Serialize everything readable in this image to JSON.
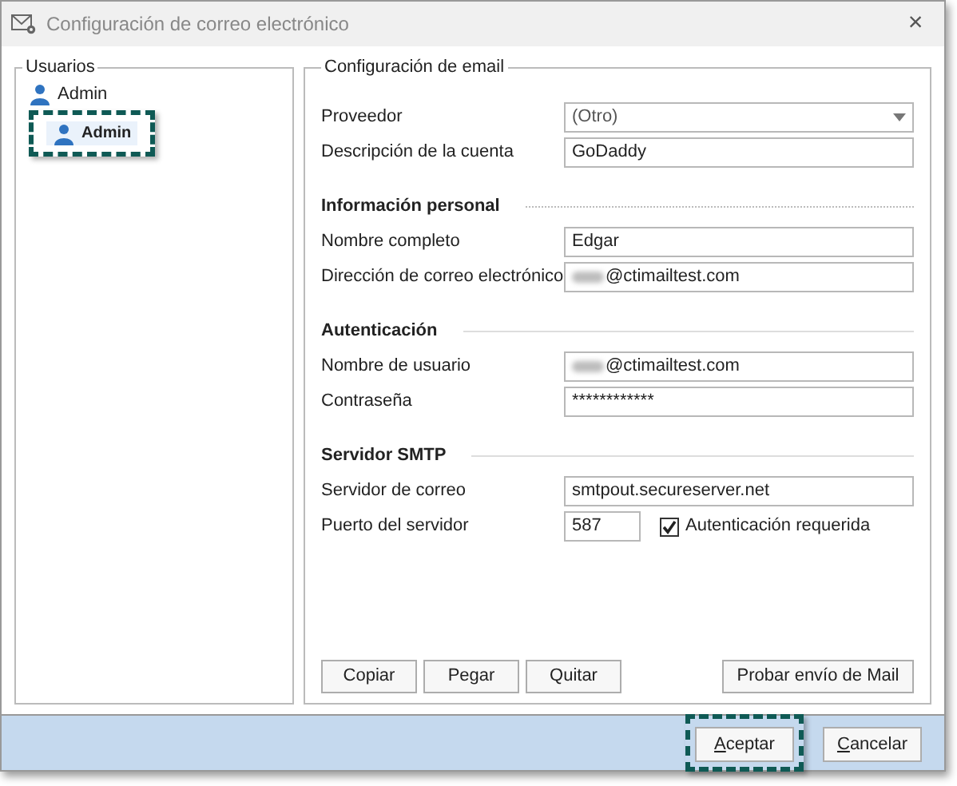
{
  "window": {
    "title": "Configuración de correo electrónico",
    "close": "×"
  },
  "users": {
    "title": "Usuarios",
    "tree": [
      {
        "label": "Admin",
        "selected": false,
        "children": [
          {
            "label": "Admin",
            "selected": true,
            "highlighted": true
          }
        ]
      }
    ]
  },
  "email": {
    "title": "Configuración de email",
    "sections": [
      {
        "fields": [
          {
            "kind": "select",
            "label": "Proveedor",
            "value": "(Otro)"
          },
          {
            "kind": "text",
            "label": "Descripción de la cuenta",
            "value": "GoDaddy"
          }
        ]
      },
      {
        "heading": "Información personal",
        "dotted": true,
        "fields": [
          {
            "kind": "text",
            "label": "Nombre completo",
            "value": "Edgar"
          },
          {
            "kind": "blurred",
            "label": "Dirección de correo electrónico",
            "value": "@ctimailtest.com"
          }
        ]
      },
      {
        "heading": "Autenticación",
        "dotted": false,
        "fields": [
          {
            "kind": "blurred",
            "label": "Nombre de usuario",
            "value": "@ctimailtest.com"
          },
          {
            "kind": "text",
            "label": "Contraseña",
            "value": "************"
          }
        ]
      },
      {
        "heading": "Servidor SMTP",
        "dotted": false,
        "fields": [
          {
            "kind": "text",
            "label": "Servidor de correo",
            "value": "smtpout.secureserver.net"
          },
          {
            "kind": "port",
            "label": "Puerto del servidor",
            "value": "587",
            "checkbox": {
              "label": "Autenticación requerida",
              "checked": true
            }
          }
        ]
      }
    ],
    "buttons": [
      "Copiar",
      "Pegar",
      "Quitar"
    ],
    "test_button": "Probar envío de Mail"
  },
  "footer": {
    "buttons": [
      {
        "label": "Aceptar",
        "highlighted": true
      },
      {
        "label": "Cancelar",
        "highlighted": false
      }
    ]
  }
}
